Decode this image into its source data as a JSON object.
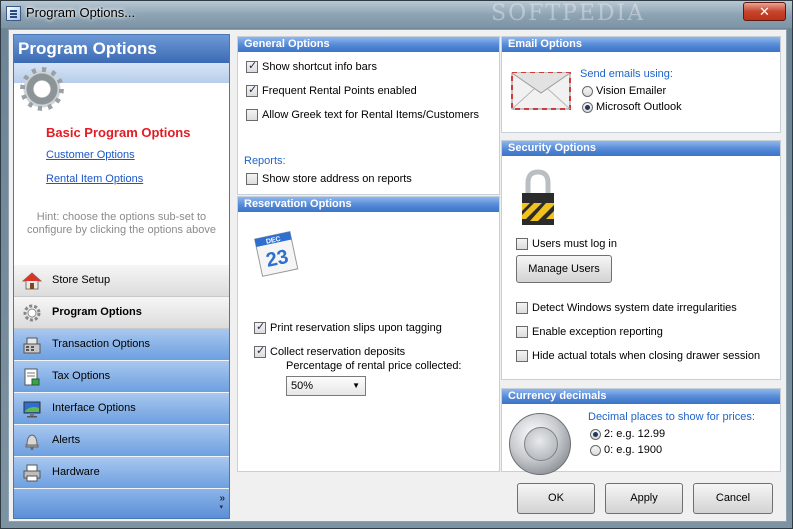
{
  "window": {
    "title": "Program Options...",
    "close_glyph": "✕",
    "watermark": "SOFTPEDIA"
  },
  "sidebar": {
    "header": "Program Options",
    "selected_label": "Basic Program Options",
    "links": [
      "Customer Options",
      "Rental Item Options"
    ],
    "hint": "Hint: choose the options sub-set to configure by clicking the options above",
    "items": [
      {
        "label": "Store Setup",
        "icon": "house-icon"
      },
      {
        "label": "Program Options",
        "icon": "gear-icon"
      },
      {
        "label": "Transaction Options",
        "icon": "cash-register-icon"
      },
      {
        "label": "Tax Options",
        "icon": "tax-document-icon"
      },
      {
        "label": "Interface Options",
        "icon": "monitor-icon"
      },
      {
        "label": "Alerts",
        "icon": "bell-icon"
      },
      {
        "label": "Hardware",
        "icon": "printer-icon"
      }
    ],
    "expand_glyph": "»"
  },
  "general": {
    "title": "General Options",
    "opt1": "Show shortcut info bars",
    "opt2": "Frequent Rental Points enabled",
    "opt3": "Allow Greek text for Rental Items/Customers",
    "reports_label": "Reports:",
    "opt4": "Show store address on reports"
  },
  "reservation": {
    "title": "Reservation Options",
    "calendar_month": "DEC",
    "calendar_day": "23",
    "opt1": "Print reservation slips upon tagging",
    "opt2": "Collect reservation deposits",
    "pct_label": "Percentage of rental price collected:",
    "pct_value": "50%"
  },
  "email": {
    "title": "Email Options",
    "send_label": "Send emails using:",
    "opt1": "Vision Emailer",
    "opt2": "Microsoft Outlook"
  },
  "security": {
    "title": "Security Options",
    "opt1": "Users must log in",
    "manage_users": "Manage Users",
    "opt2": "Detect Windows system date irregularities",
    "opt3": "Enable exception reporting",
    "opt4": "Hide actual totals when closing drawer session"
  },
  "currency": {
    "title": "Currency decimals",
    "prompt": "Decimal places to show for prices:",
    "opt1": "2: e.g. 12.99",
    "opt2": "0: e.g. 1900"
  },
  "buttons": {
    "ok": "OK",
    "apply": "Apply",
    "cancel": "Cancel"
  },
  "colors": {
    "accent": "#3e74c6",
    "selected_text": "#e31b23",
    "link": "#1a57c9"
  }
}
